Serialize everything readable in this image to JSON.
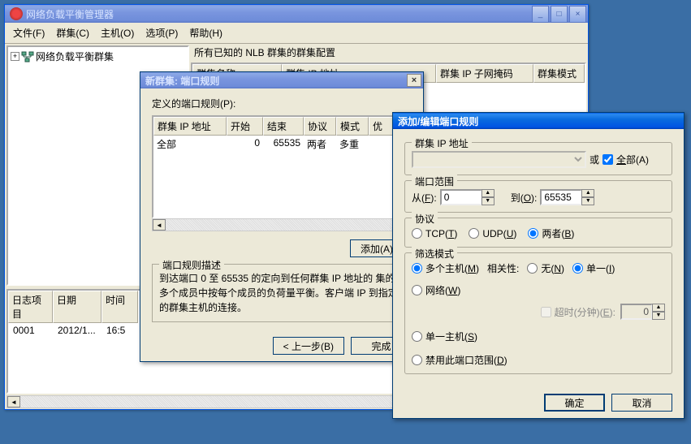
{
  "main_window": {
    "title": "网络负载平衡管理器",
    "menu": {
      "file": "文件(F)",
      "cluster": "群集(C)",
      "host": "主机(O)",
      "options": "选项(P)",
      "help": "帮助(H)"
    },
    "tree": {
      "root": "网络负载平衡群集"
    },
    "config_label": "所有已知的 NLB 群集的群集配置",
    "cols": {
      "name": "群集名称",
      "ip": "群集 IP 地址",
      "mask": "群集 IP 子网掩码",
      "mode": "群集模式"
    },
    "log_cols": {
      "item": "日志项目",
      "date": "日期",
      "time": "时间"
    },
    "log_row": {
      "item": "0001",
      "date": "2012/1...",
      "time": "16:5"
    }
  },
  "wiz": {
    "title": "新群集:  端口规则",
    "defined": "定义的端口规则(P):",
    "cols": {
      "ip": "群集 IP 地址",
      "start": "开始",
      "end": "结束",
      "proto": "协议",
      "mode": "模式",
      "extra": "优"
    },
    "row": {
      "ip": "全部",
      "start": "0",
      "end": "65535",
      "proto": "两者",
      "mode": "多重"
    },
    "add": "添加(A)...",
    "desc_legend": "端口规则描述",
    "desc": "到达端口 0 至 65535 的定向到任何群集 IP 地址的 集的多个成员中按每个成员的负荷量平衡。客户端 IP 到指定的群集主机的连接。",
    "back": "< 上一步(B)",
    "finish": "完成"
  },
  "port_dlg": {
    "title": "添加/编辑端口规则",
    "ip_legend": "群集 IP 地址",
    "or": "或",
    "all": "全部(A)",
    "range_legend": "端口范围",
    "from": "从(F):",
    "from_val": "0",
    "to": "到(O):",
    "to_val": "65535",
    "proto_legend": "协议",
    "tcp": "TCP(T)",
    "udp": "UDP(U)",
    "both": "两者(B)",
    "filter_legend": "筛选模式",
    "multi": "多个主机(M)",
    "affinity": "相关性:",
    "aff_none": "无(N)",
    "aff_single": "单一(I)",
    "aff_net": "网络(W)",
    "timeout": "超时(分钟)(E):",
    "timeout_val": "0",
    "single": "单一主机(S)",
    "disable": "禁用此端口范围(D)",
    "ok": "确定",
    "cancel": "取消"
  }
}
